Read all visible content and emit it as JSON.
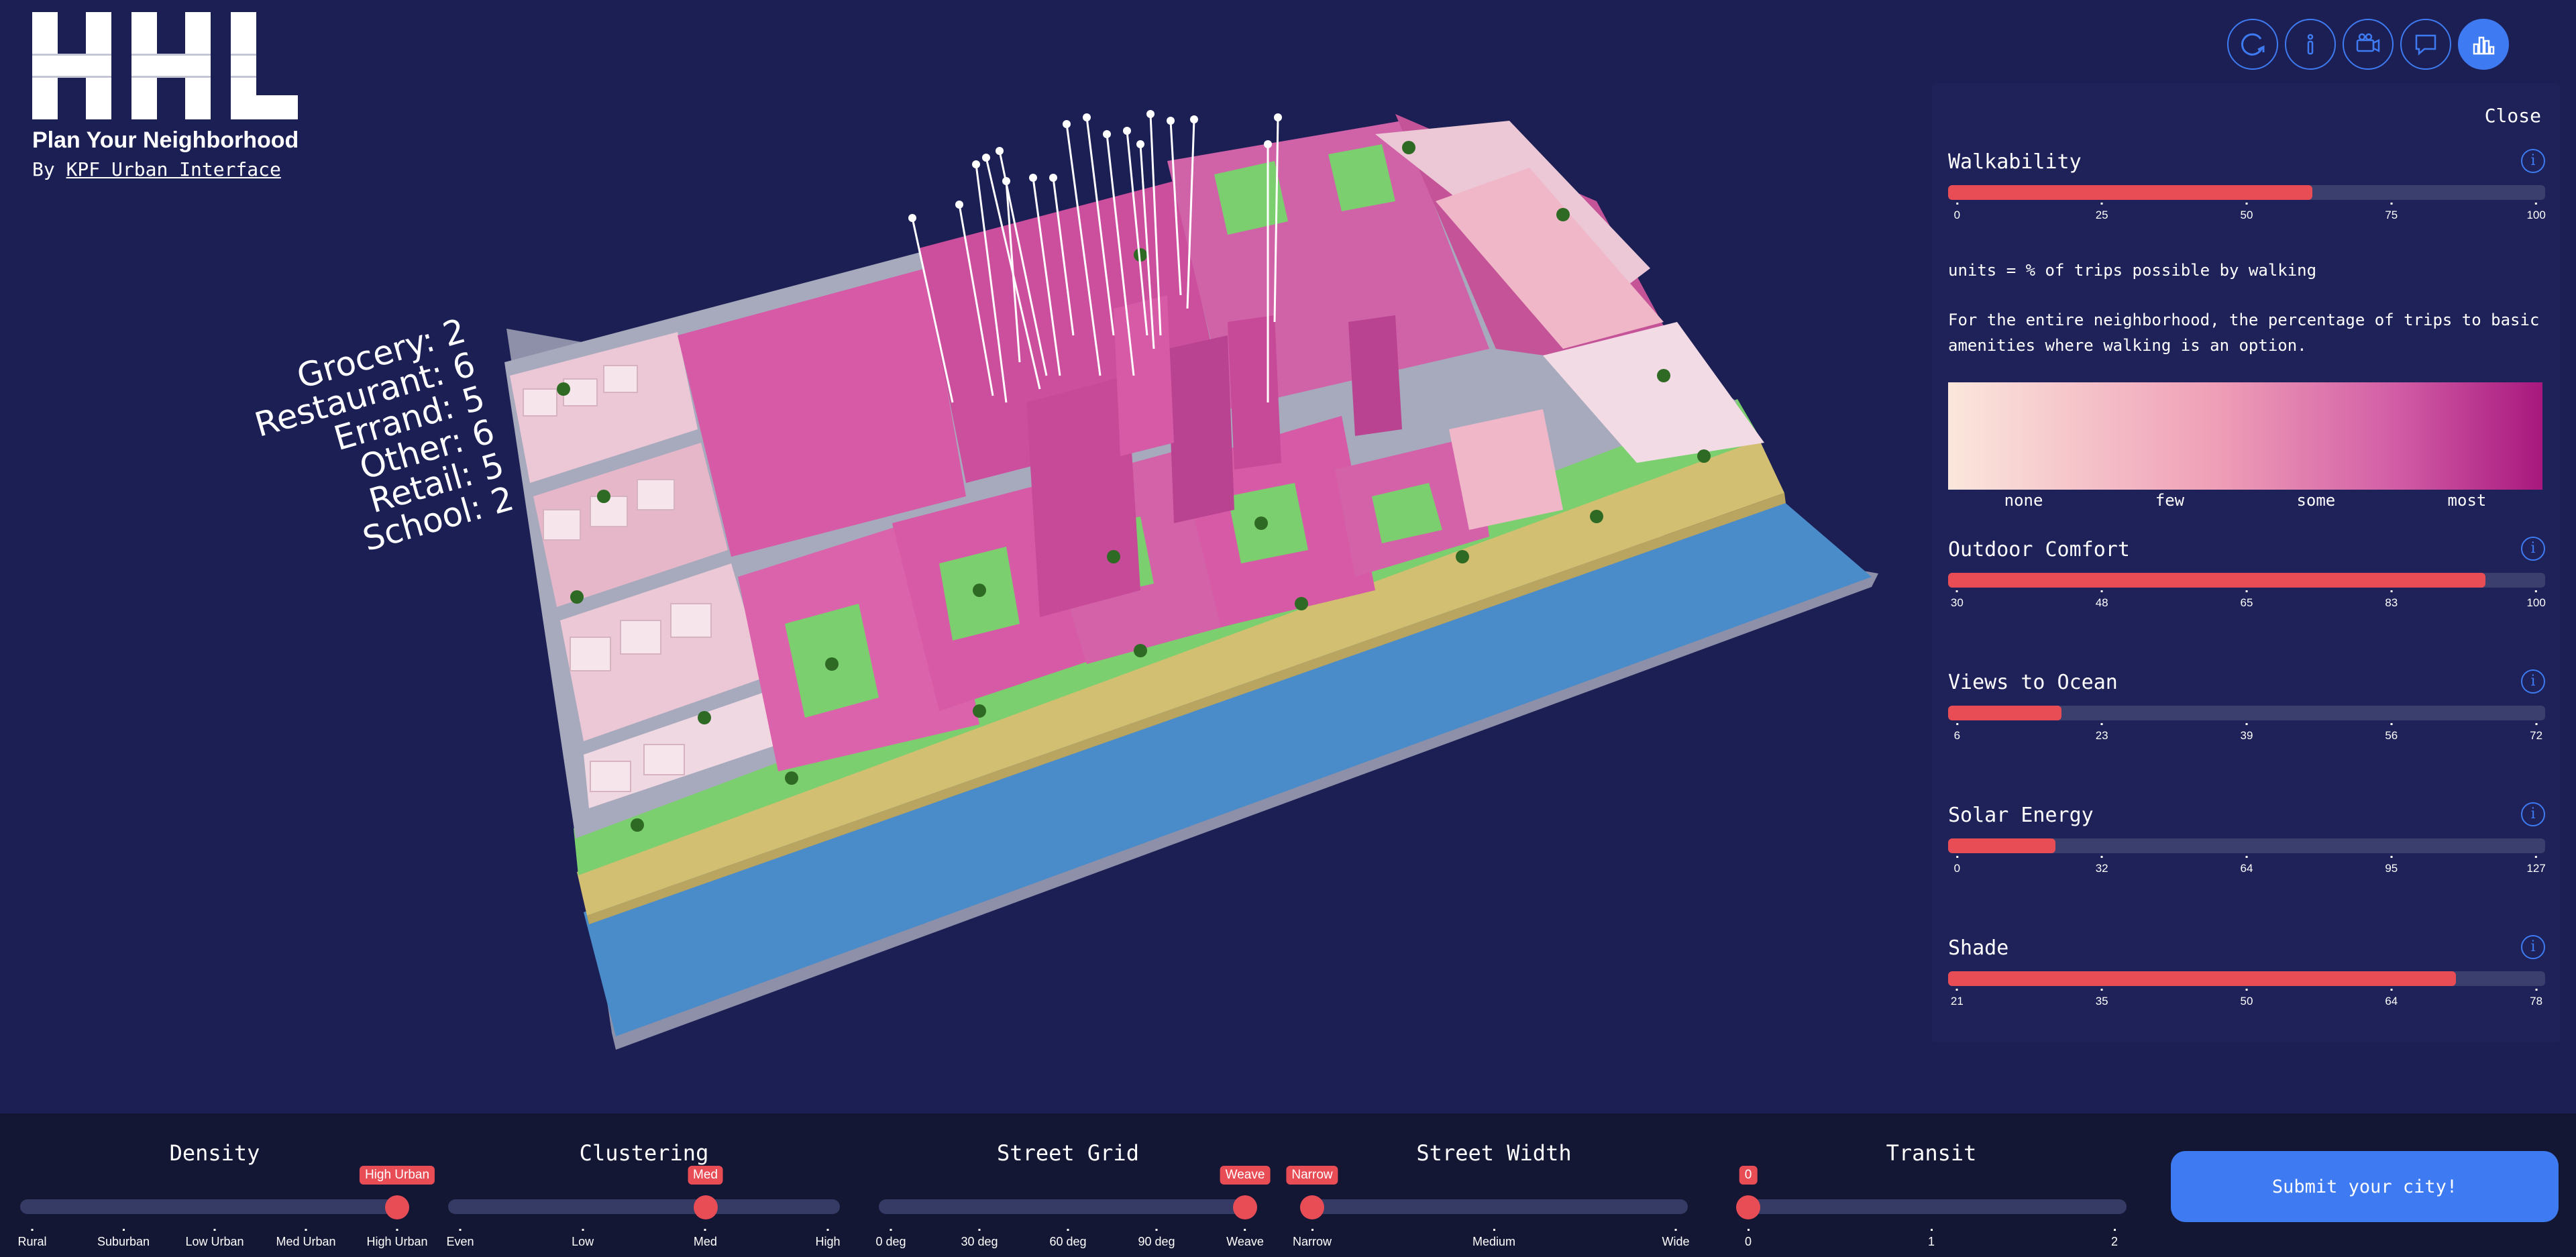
{
  "app": {
    "logo_text": "HHL",
    "title": "Plan Your Neighborhood",
    "byline_prefix": "By",
    "byline_link": "KPF Urban Interface"
  },
  "amenities": [
    {
      "label": "Grocery: 2"
    },
    {
      "label": "Restaurant: 6"
    },
    {
      "label": "Errand: 5"
    },
    {
      "label": "Other: 6"
    },
    {
      "label": "Retail: 5"
    },
    {
      "label": "School: 2"
    }
  ],
  "toolbar": {
    "icons": [
      "refresh-icon",
      "info-icon",
      "camera-icon",
      "chat-icon",
      "bar-chart-icon"
    ],
    "active": "bar-chart-icon"
  },
  "panel": {
    "close_label": "Close",
    "metrics": [
      {
        "name": "Walkability",
        "fill": 0.61,
        "ticks": [
          "0",
          "25",
          "50",
          "75",
          "100"
        ]
      },
      {
        "name": "Outdoor Comfort",
        "fill": 0.9,
        "ticks": [
          "30",
          "48",
          "65",
          "83",
          "100"
        ]
      },
      {
        "name": "Views to Ocean",
        "fill": 0.19,
        "ticks": [
          "6",
          "23",
          "39",
          "56",
          "72"
        ]
      },
      {
        "name": "Solar Energy",
        "fill": 0.18,
        "ticks": [
          "0",
          "32",
          "64",
          "95",
          "127"
        ]
      },
      {
        "name": "Shade",
        "fill": 0.85,
        "ticks": [
          "21",
          "35",
          "50",
          "64",
          "78"
        ]
      }
    ],
    "units_text": "units = % of trips possible by walking",
    "description": "For the entire neighborhood, the percentage of trips to basic amenities where walking is an option.",
    "legend_labels": [
      "none",
      "few",
      "some",
      "most"
    ],
    "legend_colors": [
      "#fbe7dc",
      "#ef9fb7",
      "#d25ea6",
      "#a8187e"
    ]
  },
  "controls": [
    {
      "title": "Density",
      "ticks": [
        "Rural",
        "Suburban",
        "Low Urban",
        "Med Urban",
        "High Urban"
      ],
      "value": "High Urban",
      "position": 1.0
    },
    {
      "title": "Clustering",
      "ticks": [
        "Even",
        "Low",
        "Med",
        "High"
      ],
      "value": "Med",
      "position": 0.667
    },
    {
      "title": "Street Grid",
      "ticks": [
        "0 deg",
        "30 deg",
        "60 deg",
        "90 deg",
        "Weave"
      ],
      "value": "Weave",
      "position": 1.0
    },
    {
      "title": "Street Width",
      "ticks": [
        "Narrow",
        "Medium",
        "Wide"
      ],
      "value": "Narrow",
      "position": 0.0
    },
    {
      "title": "Transit",
      "ticks": [
        "0",
        "1",
        "2"
      ],
      "value": "0",
      "position": 0.0
    }
  ],
  "submit_label": "Submit your city!",
  "colors": {
    "background": "#1c1f54",
    "accent": "#3e7bf2",
    "slider_fill": "#e84c55",
    "building_pink": "#d65aa6",
    "building_light": "#ecc8d6",
    "park_green": "#7bcf6e",
    "sand": "#d2bf72",
    "water": "#4a8bc9"
  }
}
